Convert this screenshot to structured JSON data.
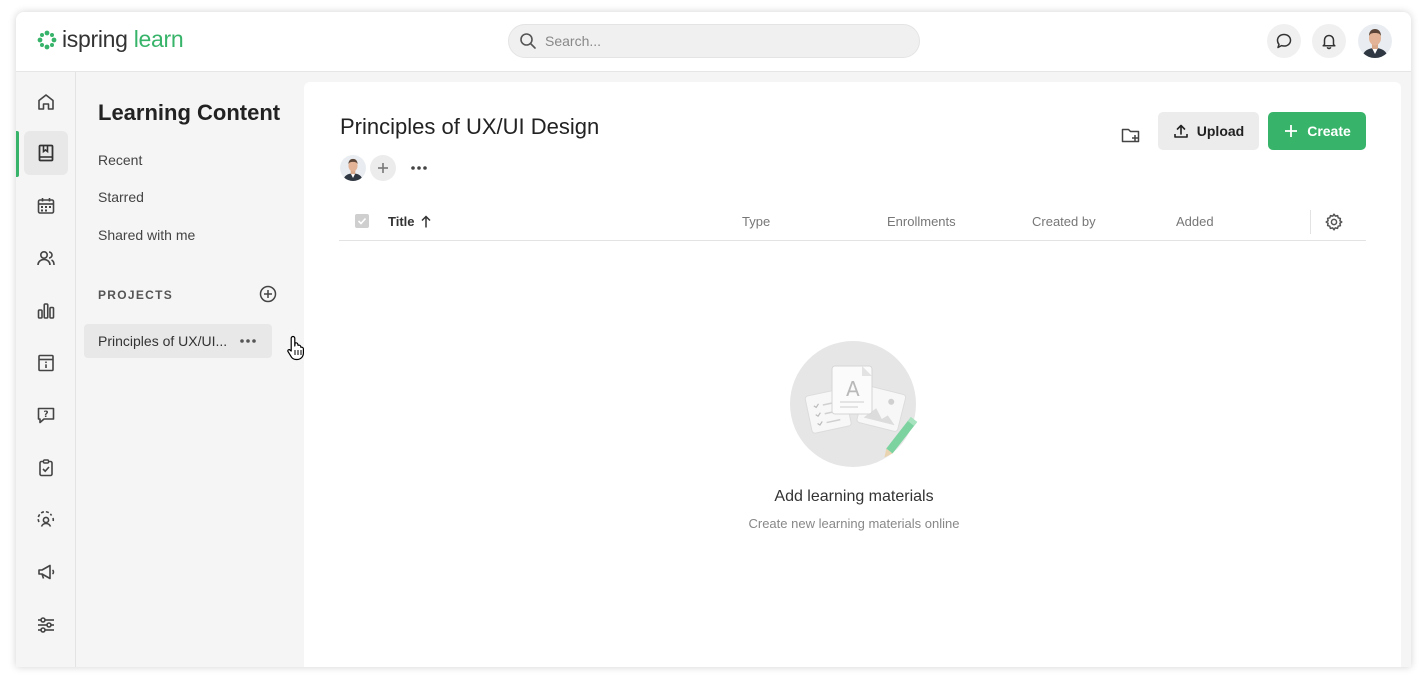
{
  "brand": {
    "name_part1": "ispring",
    "name_part2": "learn",
    "accent": "#38b46a"
  },
  "search": {
    "placeholder": "Search..."
  },
  "header_icons": [
    "chat-icon",
    "bell-icon",
    "user-avatar"
  ],
  "rail_icons": [
    "home-icon",
    "book-icon",
    "calendar-icon",
    "users-icon",
    "chart-icon",
    "info-card-icon",
    "question-chat-icon",
    "clipboard-check-icon",
    "user-badge-icon",
    "megaphone-icon",
    "sliders-icon"
  ],
  "sidebar": {
    "title": "Learning Content",
    "links": [
      "Recent",
      "Starred",
      "Shared with me"
    ],
    "projects_label": "PROJECTS",
    "project_item": "Principles of UX/UI..."
  },
  "main": {
    "title": "Principles of UX/UI Design",
    "upload_label": "Upload",
    "create_label": "Create",
    "columns": {
      "title": "Title",
      "type": "Type",
      "enrollments": "Enrollments",
      "created_by": "Created by",
      "added": "Added"
    },
    "empty": {
      "title": "Add learning materials",
      "subtitle": "Create new learning materials online"
    }
  }
}
